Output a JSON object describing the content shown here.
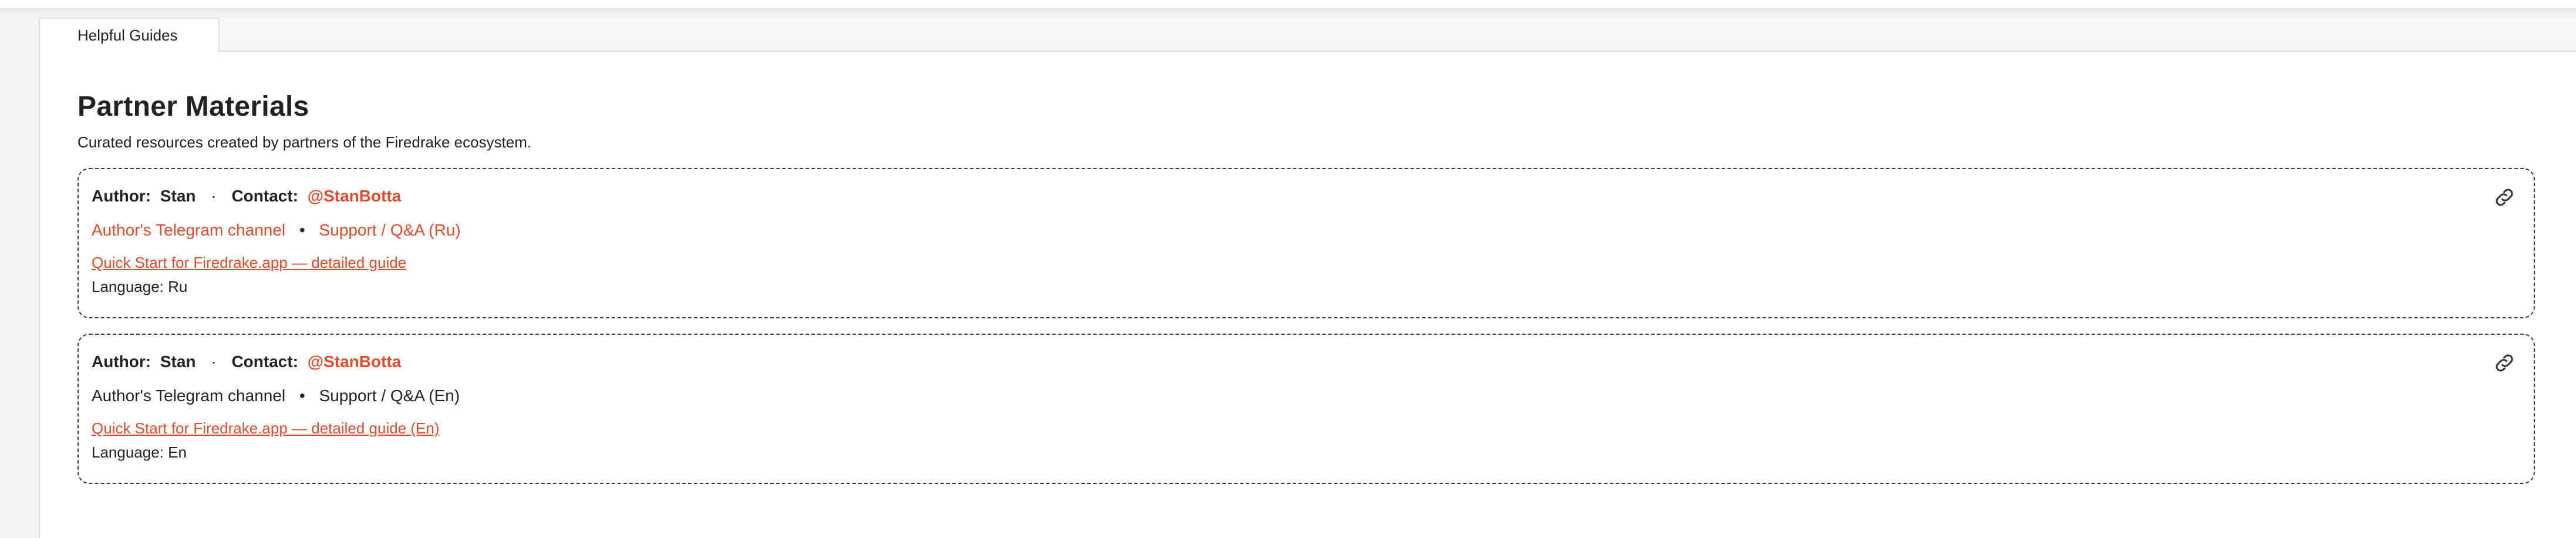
{
  "tabs": [
    {
      "label": "Helpful Guides",
      "active": true
    }
  ],
  "page": {
    "title": "Partner Materials",
    "subtitle": "Curated resources created by partners of the Firedrake ecosystem."
  },
  "cards": [
    {
      "author_label": "Author:",
      "author": "Stan",
      "separator": "·",
      "contact_label": "Contact:",
      "contact": "@StanBotta",
      "channel_link": "Author's Telegram channel",
      "bullet": "•",
      "support_link": "Support / Q&A (Ru)",
      "guide_link": "Quick Start for Firedrake.app — detailed guide",
      "language": "Language: Ru",
      "icon": "link-icon"
    },
    {
      "author_label": "Author:",
      "author": "Stan",
      "separator": "·",
      "contact_label": "Contact:",
      "contact": "@StanBotta",
      "channel_link": "Author's Telegram channel",
      "bullet": "•",
      "support_link": "Support / Q&A (En)",
      "guide_link": "Quick Start for Firedrake.app — detailed guide (En)",
      "language": "Language: En",
      "icon": "link-icon"
    }
  ],
  "colors": {
    "accent": "#e14a2a",
    "text": "#222222",
    "border": "#3a3a3a"
  }
}
